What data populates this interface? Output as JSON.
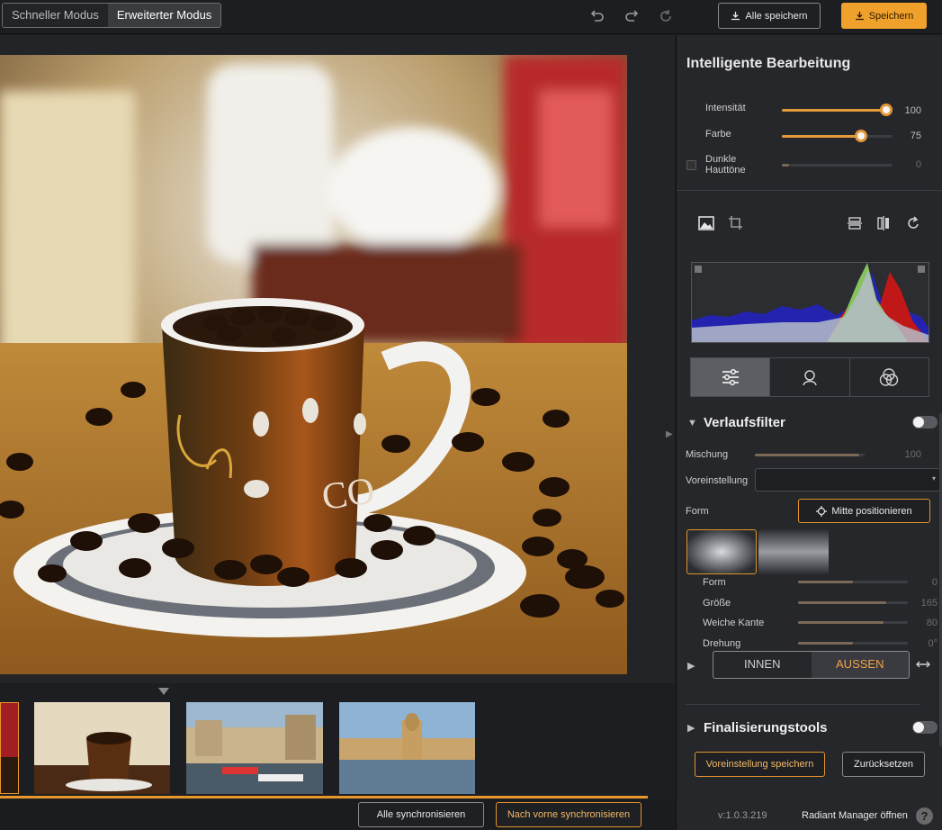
{
  "topbar": {
    "mode_quick": "Schneller Modus",
    "mode_advanced": "Erweiterter Modus",
    "save_all": "Alle speichern",
    "save": "Speichern"
  },
  "panel": {
    "title": "Intelligente Bearbeitung",
    "sliders": [
      {
        "label": "Intensität",
        "value": "100",
        "level": 100
      },
      {
        "label": "Farbe",
        "value": "75",
        "level": 75
      },
      {
        "label": "Dunkle Hauttöne",
        "value": "0",
        "level": 0
      }
    ],
    "gradient": {
      "title": "Verlaufsfilter",
      "mix_label": "Mischung",
      "mix_value": "100",
      "preset_label": "Voreinstellung",
      "shape_label": "Form",
      "center_button": "Mitte positionieren",
      "sub_sliders": [
        {
          "label": "Form",
          "value": "0",
          "level": 50
        },
        {
          "label": "Größe",
          "value": "165",
          "level": 80
        },
        {
          "label": "Weiche Kante",
          "value": "80",
          "level": 78
        },
        {
          "label": "Drehung",
          "value": "0°",
          "level": 50
        }
      ],
      "inside": "INNEN",
      "outside": "AUSSEN"
    },
    "finishing": {
      "title": "Finalisierungstools"
    },
    "save_preset": "Voreinstellung speichern",
    "reset": "Zurücksetzen",
    "version": "v:1.0.3.219",
    "open_manager": "Radiant Manager öffnen",
    "help": "?"
  },
  "bottom": {
    "sync_all": "Alle synchronisieren",
    "sync_forward": "Nach vorne synchronisieren"
  },
  "colors": {
    "accent": "#f0a12c",
    "panel_bg": "#26272b",
    "app_bg": "#1b1c1f"
  }
}
